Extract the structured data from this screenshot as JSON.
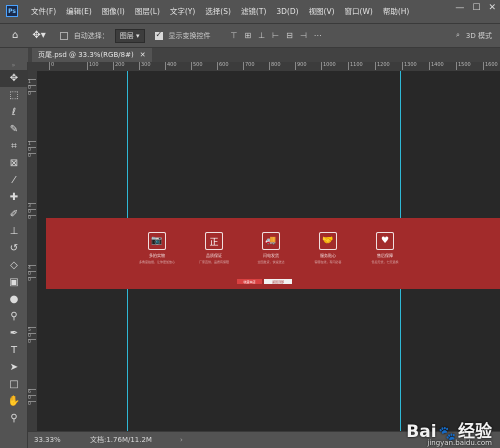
{
  "app": {
    "logo": "Ps"
  },
  "menu": [
    "文件(F)",
    "编辑(E)",
    "图像(I)",
    "图层(L)",
    "文字(Y)",
    "选择(S)",
    "滤镜(T)",
    "3D(D)",
    "视图(V)",
    "窗口(W)",
    "帮助(H)"
  ],
  "window_controls": {
    "minimize": "—",
    "maximize": "☐",
    "close": "✕"
  },
  "options": {
    "auto_select_label": "自动选择：",
    "auto_select_checked": false,
    "layer_dropdown": "图层",
    "show_transform_label": "显示变换控件",
    "show_transform_checked": true,
    "mode_3d": "3D 模式"
  },
  "tab": {
    "title": "页尾.psd @ 33.3%(RGB/8#)",
    "close": "✕"
  },
  "ruler": {
    "h": [
      "0",
      "100",
      "200",
      "300",
      "400",
      "500",
      "600",
      "700",
      "800",
      "900",
      "1000",
      "1100",
      "1200",
      "1300",
      "1400",
      "1500",
      "1600",
      "1700",
      "1800"
    ],
    "v": [
      "1",
      "0",
      "0",
      "1",
      "0",
      "0",
      "0",
      "0",
      "3",
      "0",
      "0",
      "0",
      "4",
      "0",
      "0",
      "0",
      "5",
      "0",
      "0",
      "0",
      "6",
      "0",
      "0",
      "7",
      "0",
      "0",
      "0",
      "8",
      "0",
      "0",
      "0"
    ]
  },
  "banner": {
    "features": [
      {
        "icon": "camera-icon",
        "glyph": "📷",
        "title": "多拍实物",
        "sub": "多角度拍摄，让你更加放心"
      },
      {
        "icon": "shield-icon",
        "glyph": "正",
        "title": "品质保证",
        "sub": "厂家直供，品质有保障"
      },
      {
        "icon": "truck-icon",
        "glyph": "🚚",
        "title": "闪电发货",
        "sub": "全国发货，快速送达"
      },
      {
        "icon": "handshake-icon",
        "glyph": "🤝",
        "title": "服务贴心",
        "sub": "客服在线，有问必答"
      },
      {
        "icon": "heart-icon",
        "glyph": "♥",
        "title": "售后保障",
        "sub": "售后无忧，七天退换"
      }
    ],
    "button_primary": "收藏本店",
    "button_secondary": "返回顶部"
  },
  "status": {
    "zoom": "33.33%",
    "doc": "文档:1.76M/11.2M",
    "arrow": "›"
  },
  "watermark": {
    "brand": "Bai",
    "paw": "🐾",
    "brand2": "经验",
    "url": "jingyan.baidu.com"
  }
}
